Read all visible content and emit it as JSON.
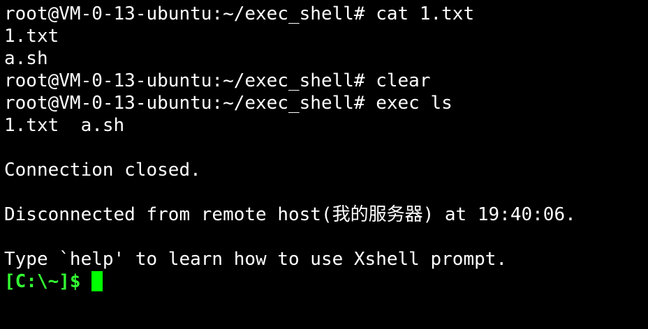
{
  "terminal": {
    "lines": [
      "root@VM-0-13-ubuntu:~/exec_shell# cat 1.txt",
      "1.txt",
      "a.sh",
      "root@VM-0-13-ubuntu:~/exec_shell# clear",
      "root@VM-0-13-ubuntu:~/exec_shell# exec ls",
      "1.txt  a.sh",
      "",
      "Connection closed.",
      "",
      "Disconnected from remote host(我的服务器) at 19:40:06.",
      "",
      "Type `help' to learn how to use Xshell prompt."
    ],
    "prompt": "[C:\\~]$ ",
    "colors": {
      "background": "#000000",
      "text": "#ffffff",
      "prompt": "#33ff33",
      "cursor": "#00ff00"
    }
  }
}
